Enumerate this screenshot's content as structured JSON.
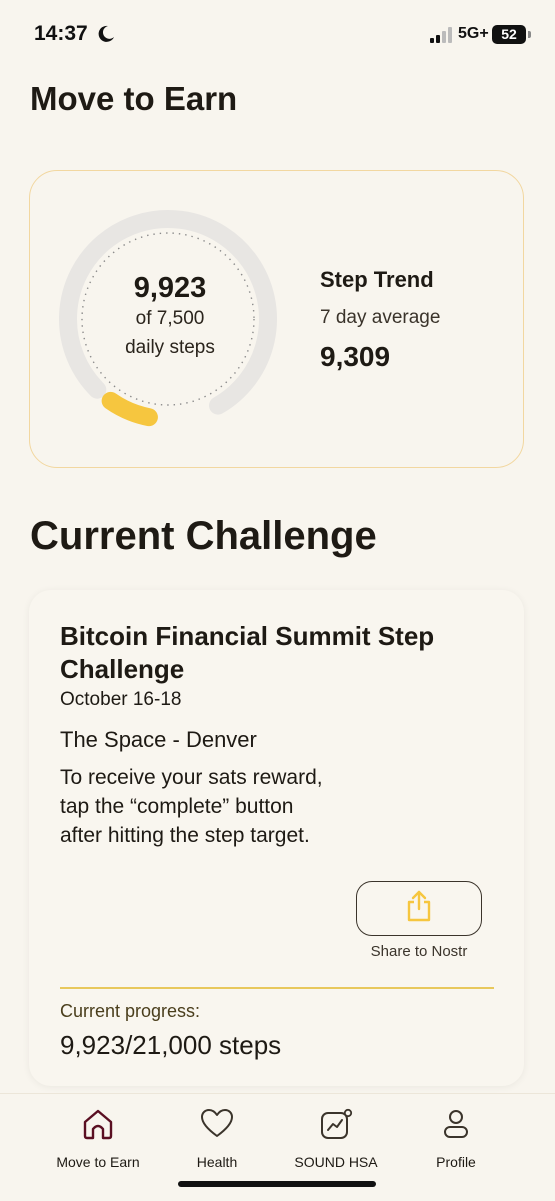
{
  "status_bar": {
    "time": "14:37",
    "network": "5G+",
    "battery": "52",
    "icons": [
      "moon-icon",
      "signal-icon",
      "battery-icon"
    ]
  },
  "page_title": "Move to Earn",
  "steps_card": {
    "steps_count": "9,923",
    "goal_text": "of 7,500",
    "goal_label": "daily steps",
    "ring_progress": 0.08,
    "trend_title": "Step Trend",
    "trend_subtitle": "7 day average",
    "trend_value": "9,309"
  },
  "current_challenge": {
    "section_title": "Current Challenge",
    "title": "Bitcoin Financial Summit Step Challenge",
    "dates": "October 16-18",
    "venue": "The Space - Denver",
    "description": "To receive your sats reward, tap the “complete” button after hitting the step target.",
    "share_label": "Share to Nostr",
    "progress_label": "Current progress:",
    "progress_value": "9,923/21,000 steps"
  },
  "bottom_nav": {
    "items": [
      {
        "label": "Move to Earn",
        "icon": "home-icon"
      },
      {
        "label": "Health",
        "icon": "heart-icon"
      },
      {
        "label": "SOUND HSA",
        "icon": "chart-icon"
      },
      {
        "label": "Profile",
        "icon": "profile-icon"
      }
    ]
  },
  "colors": {
    "background": "#f8f5ee",
    "accent": "#f6c63f",
    "card_border": "#f2d7a0",
    "ring_track": "#e8e6e3",
    "text": "#1e1a14"
  }
}
